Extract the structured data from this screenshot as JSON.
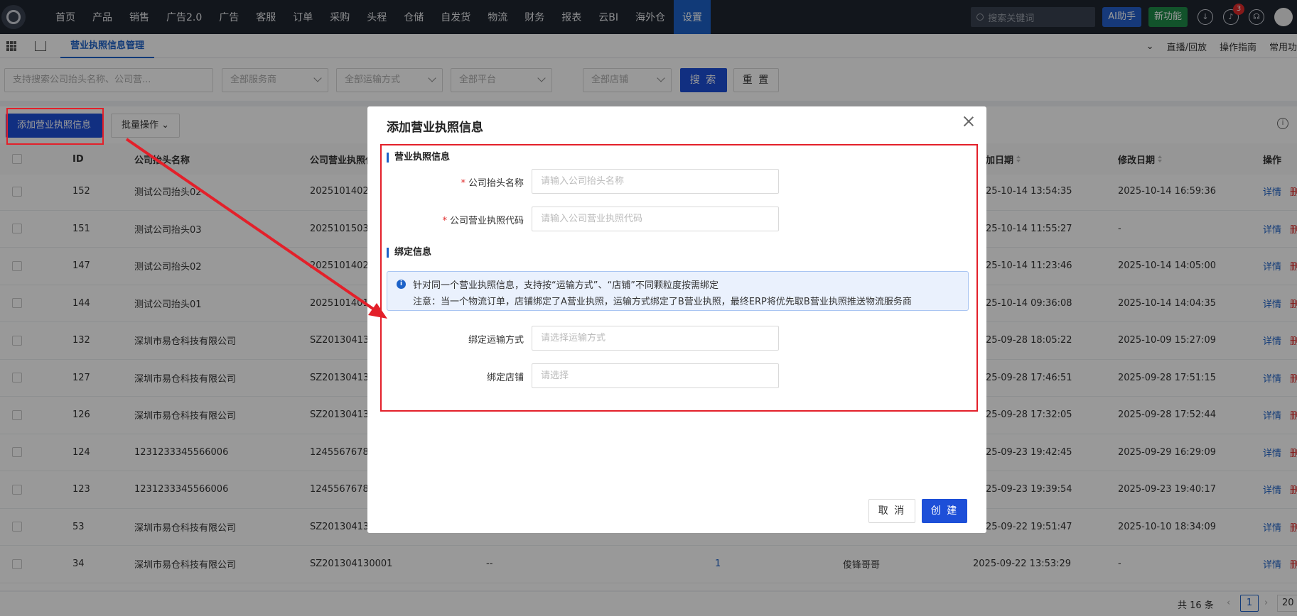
{
  "topnav": {
    "items": [
      "首页",
      "产品",
      "销售",
      "广告2.0",
      "广告",
      "客服",
      "订单",
      "采购",
      "头程",
      "仓储",
      "自发货",
      "物流",
      "财务",
      "报表",
      "云BI",
      "海外仓",
      "设置"
    ],
    "active_index": 16,
    "search_placeholder": "搜索关键词",
    "ai_label": "AI助手",
    "new_feature_label": "新功能",
    "notification_count": "3"
  },
  "tabbar": {
    "active_tab": "营业执照信息管理",
    "right": [
      "直播/回放",
      "操作指南",
      "常用功"
    ]
  },
  "filters": {
    "search_placeholder": "支持搜索公司抬头名称、公司营...",
    "service": "全部服务商",
    "shipping": "全部运输方式",
    "platform": "全部平台",
    "store": "全部店铺",
    "search_btn": "搜 索",
    "reset_btn": "重 置"
  },
  "actions": {
    "add_label": "添加营业执照信息",
    "batch_label": "批量操作"
  },
  "table": {
    "headers": {
      "id": "ID",
      "name": "公司抬头名称",
      "code": "公司营业执照代",
      "created": "加日期",
      "modified": "修改日期",
      "ops": "操作"
    },
    "rows": [
      {
        "id": "152",
        "name": "测试公司抬头02",
        "code": "2025101402",
        "created": "25-10-14 13:54:35",
        "modified": "2025-10-14 16:59:36"
      },
      {
        "id": "151",
        "name": "测试公司抬头03",
        "code": "2025101503",
        "created": "25-10-14 11:55:27",
        "modified": "-"
      },
      {
        "id": "147",
        "name": "测试公司抬头02",
        "code": "2025101402",
        "created": "25-10-14 11:23:46",
        "modified": "2025-10-14 14:05:00"
      },
      {
        "id": "144",
        "name": "测试公司抬头01",
        "code": "2025101401",
        "created": "25-10-14 09:36:08",
        "modified": "2025-10-14 14:04:35"
      },
      {
        "id": "132",
        "name": "深圳市易仓科技有限公司",
        "code": "SZ20130413",
        "created": "25-09-28 18:05:22",
        "modified": "2025-10-09 15:27:09"
      },
      {
        "id": "127",
        "name": "深圳市易仓科技有限公司",
        "code": "SZ20130413",
        "created": "25-09-28 17:46:51",
        "modified": "2025-09-28 17:51:15"
      },
      {
        "id": "126",
        "name": "深圳市易仓科技有限公司",
        "code": "SZ20130413",
        "created": "25-09-28 17:32:05",
        "modified": "2025-09-28 17:52:44"
      },
      {
        "id": "124",
        "name": "1231233345566006",
        "code": "1245567678",
        "created": "25-09-23 19:42:45",
        "modified": "2025-09-29 16:29:09"
      },
      {
        "id": "123",
        "name": "1231233345566006",
        "code": "1245567678",
        "created": "25-09-23 19:39:54",
        "modified": "2025-09-23 19:40:17"
      },
      {
        "id": "53",
        "name": "深圳市易仓科技有限公司",
        "code": "SZ20130413",
        "created": "25-09-22 19:51:47",
        "modified": "2025-10-10 18:34:09"
      }
    ],
    "last_row": {
      "id": "34",
      "name": "深圳市易仓科技有限公司",
      "code": "SZ201304130001",
      "extra": "--",
      "count": "1",
      "owner": "俊锋哥哥",
      "created": "2025-09-22 13:53:29",
      "modified": "-"
    },
    "detail_label": "详情",
    "delete_label": "删"
  },
  "pager": {
    "total": "共 16 条",
    "page": "1",
    "size": "20"
  },
  "modal": {
    "title": "添加营业执照信息",
    "section1": "营业执照信息",
    "company_label": "公司抬头名称",
    "company_placeholder": "请输入公司抬头名称",
    "code_label": "公司营业执照代码",
    "code_placeholder": "请输入公司营业执照代码",
    "section2": "绑定信息",
    "notice_line1": "针对同一个营业执照信息，支持按“运输方式”、“店铺”不同颗粒度按需绑定",
    "notice_line2": "注意：当一个物流订单，店铺绑定了A营业执照，运输方式绑定了B营业执照，最终ERP将优先取B营业执照推送物流服务商",
    "shipping_label": "绑定运输方式",
    "shipping_placeholder": "请选择运输方式",
    "store_label": "绑定店铺",
    "store_placeholder": "请选择",
    "cancel": "取 消",
    "create": "创 建"
  },
  "colors": {
    "primary": "#1d4fd8",
    "annotation": "#e3202a",
    "nav_bg": "#1f2530"
  }
}
